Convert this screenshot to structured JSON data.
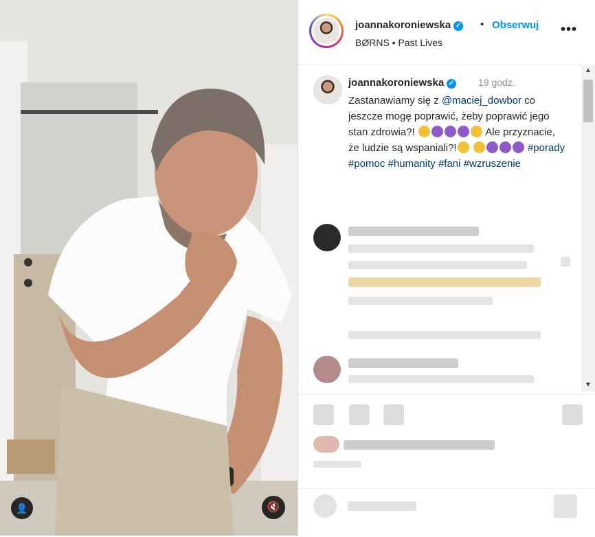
{
  "header": {
    "username": "joannakoroniewska",
    "verified_icon": "verified-badge-icon",
    "separator": "•",
    "follow_label": "Obserwuj",
    "more_label": "•••",
    "music": "BØRNS • Past Lives"
  },
  "caption": {
    "username": "joannakoroniewska",
    "time": "19 godz.",
    "text_1": "Zastanawiamy się z ",
    "mention": "@maciej_dowbor",
    "text_2": " co jeszcze mogę poprawić, żeby poprawić jego stan zdrowia?!",
    "text_3": " Ale przyznacie, że ludzie są wspaniali?!",
    "hashtags": [
      "#porady",
      "#pomoc",
      "#humanity",
      "#fani",
      "#wzruszenie"
    ]
  },
  "scrollbar": {
    "up": "▲",
    "down": "▼"
  },
  "media": {
    "mute_icon": "🔇",
    "user_icon": "👤"
  },
  "colors": {
    "accent": "#0095f6",
    "link": "#00376b"
  }
}
